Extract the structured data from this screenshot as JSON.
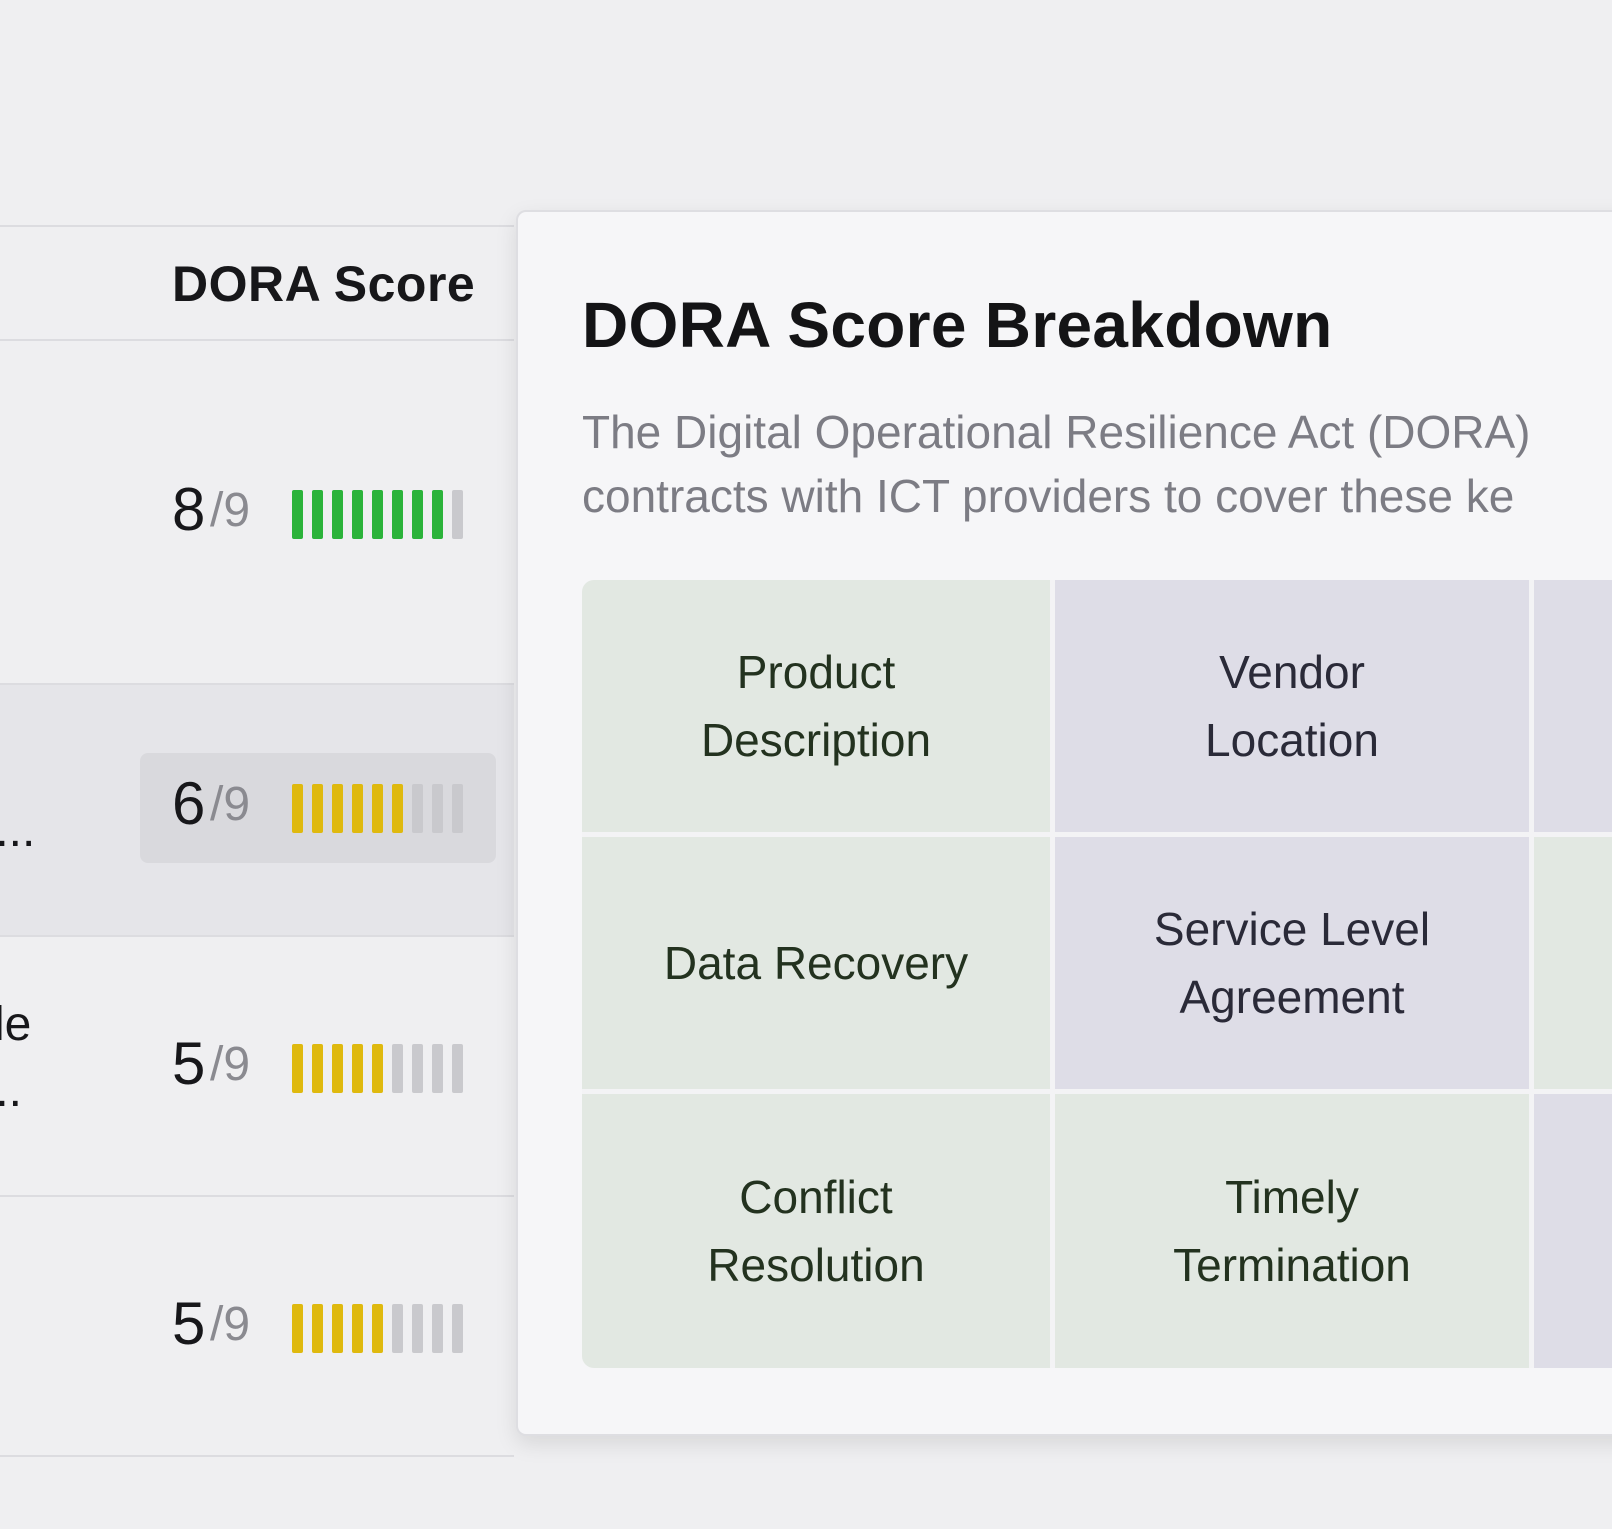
{
  "table": {
    "column_header": "DORA Score",
    "rows": [
      {
        "score": "8",
        "max": "/9",
        "filled": 8,
        "total": 9,
        "level": "green",
        "active": false,
        "left_text": []
      },
      {
        "score": "6",
        "max": "/9",
        "filled": 6,
        "total": 9,
        "level": "yellow",
        "active": true,
        "left_text": [
          "r..."
        ]
      },
      {
        "score": "5",
        "max": "/9",
        "filled": 5,
        "total": 9,
        "level": "yellow",
        "active": false,
        "left_text": [
          "le",
          "..."
        ]
      },
      {
        "score": "5",
        "max": "/9",
        "filled": 5,
        "total": 9,
        "level": "yellow",
        "active": false,
        "left_text": []
      }
    ]
  },
  "colors": {
    "green": "#2bb33a",
    "yellow": "#dfb90e",
    "empty": "#c9c9cd"
  },
  "popover": {
    "title": "DORA Score Breakdown",
    "description_line1": "The Digital Operational Resilience Act (DORA)",
    "description_line2": "contracts with ICT providers to cover these ke",
    "items": [
      {
        "label_line1": "Product",
        "label_line2": "Description",
        "status": "green"
      },
      {
        "label_line1": "Vendor",
        "label_line2": "Location",
        "status": "lavender"
      },
      {
        "label_line1": "",
        "label_line2": "",
        "status": "lavender"
      },
      {
        "label_line1": "Data Recovery",
        "label_line2": "",
        "status": "green"
      },
      {
        "label_line1": "Service Level",
        "label_line2": "Agreement",
        "status": "lavender"
      },
      {
        "label_line1": "",
        "label_line2": "",
        "status": "green"
      },
      {
        "label_line1": "Conflict",
        "label_line2": "Resolution",
        "status": "green"
      },
      {
        "label_line1": "Timely",
        "label_line2": "Termination",
        "status": "green"
      },
      {
        "label_line1": "",
        "label_line2": "",
        "status": "lavender"
      }
    ]
  }
}
